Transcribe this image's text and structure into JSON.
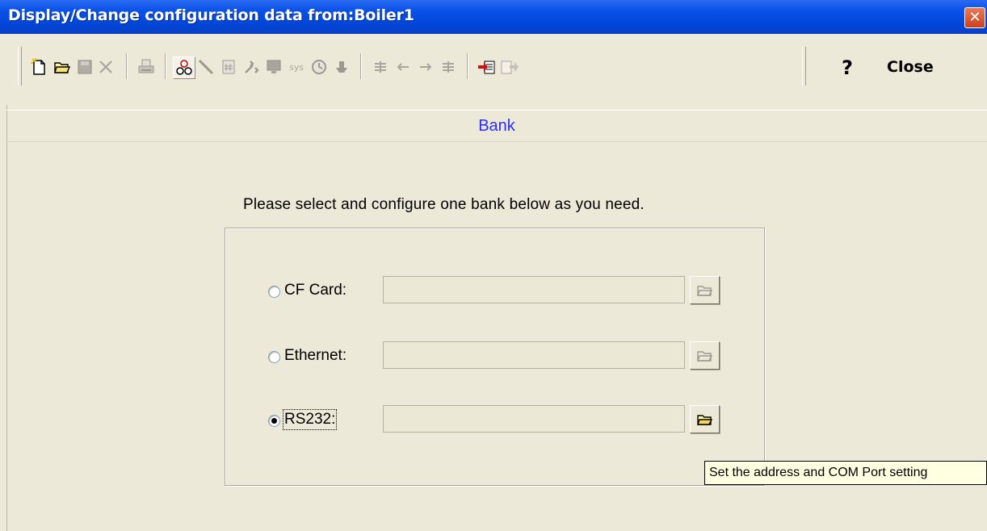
{
  "window": {
    "title": "Display/Change configuration data from:Boiler1"
  },
  "toolbar": {
    "icons": [
      "new-file-icon",
      "open-folder-icon",
      "save-icon",
      "delete-icon",
      "print-icon",
      "bank-icon",
      "line-icon",
      "calculator-icon",
      "tools-icon",
      "monitor-icon",
      "sys-icon",
      "clock-icon",
      "key-icon",
      "first-icon",
      "prev-icon",
      "next-icon",
      "last-icon",
      "import-icon",
      "export-icon"
    ],
    "sys_label": "sys",
    "help_label": "?",
    "close_label": "Close"
  },
  "section": {
    "title": "Bank"
  },
  "content": {
    "instruction": "Please select and configure one bank below as you need.",
    "options": [
      {
        "label": "CF Card:",
        "value": "",
        "selected": false,
        "enabled": false
      },
      {
        "label": "Ethernet:",
        "value": "",
        "selected": false,
        "enabled": false
      },
      {
        "label": "RS232:",
        "value": "",
        "selected": true,
        "enabled": true
      }
    ]
  },
  "tooltip": {
    "text": "Set the address and COM Port setting"
  },
  "colors": {
    "title_bar": "#0046d9",
    "section_title": "#2b2bff",
    "tooltip_bg": "#ffffe1",
    "window_bg": "#ece9d8"
  }
}
